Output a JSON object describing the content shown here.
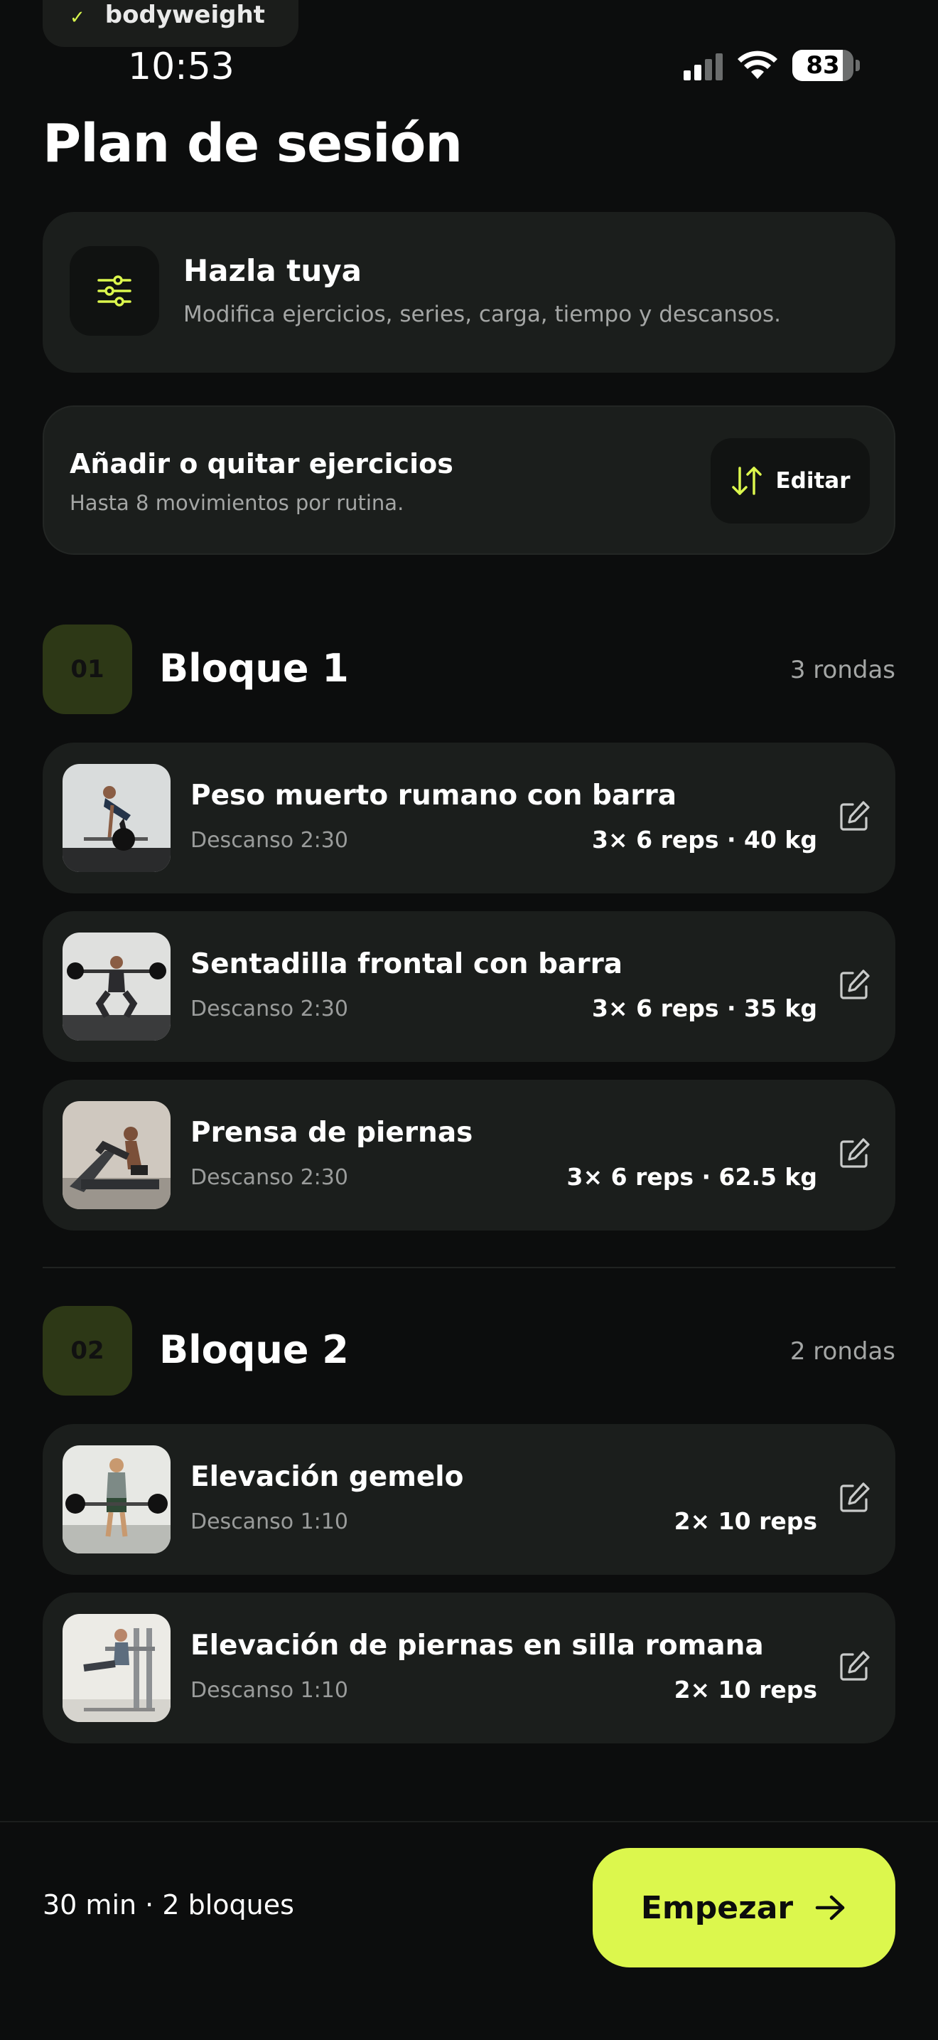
{
  "top_chip": {
    "label": "bodyweight"
  },
  "status": {
    "time": "10:53",
    "battery": "83",
    "battery_fraction": 0.83
  },
  "header": {
    "title": "Plan de sesión"
  },
  "customize": {
    "title": "Hazla tuya",
    "subtitle": "Modifica ejercicios, series, carga, tiempo y descansos.",
    "icon": "sliders-icon"
  },
  "edit_card": {
    "title": "Añadir o quitar ejercicios",
    "subtitle": "Hasta 8 movimientos por rutina.",
    "button_label": "Editar",
    "button_icon": "swap-vertical-icon"
  },
  "blocks": [
    {
      "badge": "01",
      "title": "Bloque 1",
      "rounds": "3 rondas",
      "exercises": [
        {
          "name": "Peso muerto rumano con barra",
          "rest": "Descanso 2:30",
          "meta": "3× 6 reps · 40 kg"
        },
        {
          "name": "Sentadilla frontal con barra",
          "rest": "Descanso 2:30",
          "meta": "3× 6 reps · 35 kg"
        },
        {
          "name": "Prensa de piernas",
          "rest": "Descanso 2:30",
          "meta": "3× 6 reps · 62.5 kg"
        }
      ]
    },
    {
      "badge": "02",
      "title": "Bloque 2",
      "rounds": "2 rondas",
      "exercises": [
        {
          "name": "Elevación gemelo",
          "rest": "Descanso 1:10",
          "meta": "2× 10 reps"
        },
        {
          "name": "Elevación de piernas en silla romana",
          "rest": "Descanso 1:10",
          "meta": "2× 10 reps"
        }
      ]
    }
  ],
  "footer": {
    "summary": "30 min · 2 bloques",
    "start_label": "Empezar"
  },
  "colors": {
    "accent": "#dcf74d",
    "background": "#0c0d0d",
    "card": "#1b1e1c",
    "badge": "#2d3816"
  }
}
